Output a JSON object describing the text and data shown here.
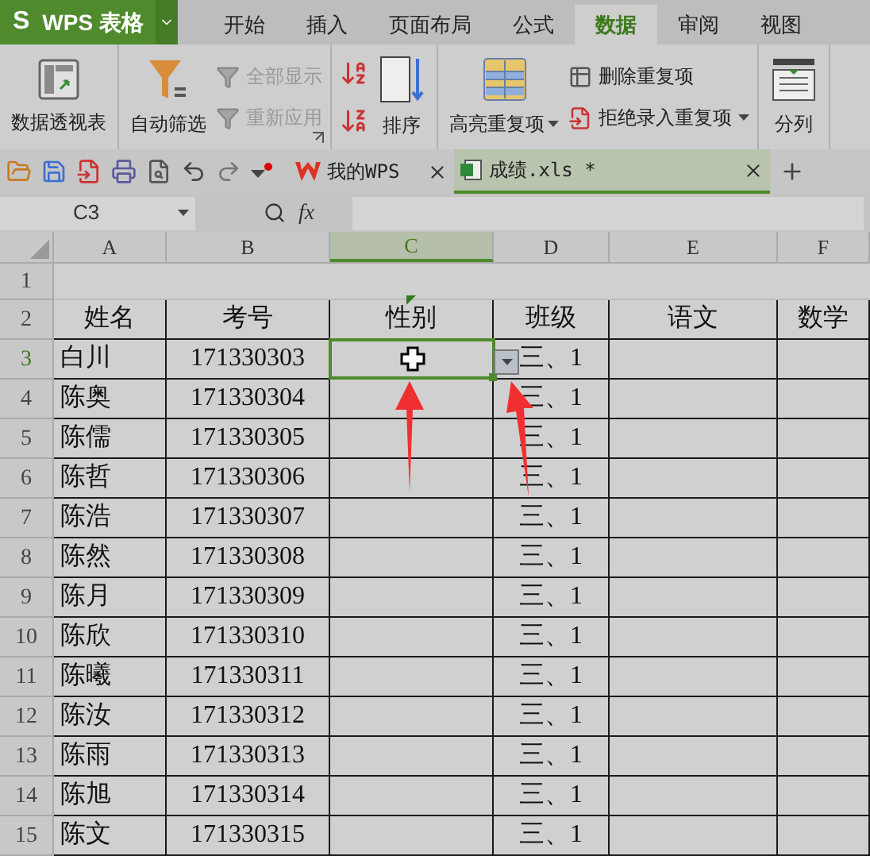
{
  "app": {
    "logo": "S",
    "name": "WPS 表格"
  },
  "menu_tabs": [
    {
      "label": "开始",
      "selected": false
    },
    {
      "label": "插入",
      "selected": false
    },
    {
      "label": "页面布局",
      "selected": false
    },
    {
      "label": "公式",
      "selected": false
    },
    {
      "label": "数据",
      "selected": true
    },
    {
      "label": "审阅",
      "selected": false
    },
    {
      "label": "视图",
      "selected": false
    }
  ],
  "ribbon_groups": [
    {
      "launcher": false,
      "items": [
        {
          "kind": "large",
          "label": "数据透视表",
          "dropdown": false
        }
      ]
    },
    {
      "launcher": true,
      "items": [
        {
          "kind": "large",
          "label": "自动筛选",
          "dropdown": false
        },
        {
          "kind": "stack",
          "items": [
            {
              "label": "全部显示",
              "disabled": true,
              "dropdown": false
            },
            {
              "label": "重新应用",
              "disabled": true,
              "dropdown": false
            }
          ]
        }
      ]
    },
    {
      "launcher": false,
      "items": [
        {
          "kind": "icon_stack"
        },
        {
          "kind": "large",
          "label": "排序",
          "dropdown": false
        }
      ]
    },
    {
      "launcher": false,
      "items": [
        {
          "kind": "large",
          "label": "高亮重复项",
          "dropdown": true
        },
        {
          "kind": "stack",
          "items": [
            {
              "label": "删除重复项",
              "disabled": false,
              "dropdown": false
            },
            {
              "label": "拒绝录入重复项",
              "disabled": false,
              "dropdown": true
            }
          ]
        }
      ]
    },
    {
      "launcher": false,
      "items": [
        {
          "kind": "large",
          "label": "分列",
          "dropdown": false
        }
      ]
    }
  ],
  "doc_tabs": [
    {
      "label": "我的WPS",
      "selected": false
    },
    {
      "label": "成绩.xls *",
      "selected": true
    }
  ],
  "formula_bar": {
    "name_box": "C3",
    "fx": "fx"
  },
  "columns": [
    {
      "label": "A",
      "selected": false
    },
    {
      "label": "B",
      "selected": false
    },
    {
      "label": "C",
      "selected": true
    },
    {
      "label": "D",
      "selected": false
    },
    {
      "label": "E",
      "selected": false
    },
    {
      "label": "F",
      "selected": false
    }
  ],
  "rows": [
    {
      "number": "1",
      "kind": "blank",
      "selected": false
    },
    {
      "number": "2",
      "kind": "header",
      "selected": false,
      "cells": [
        "姓名",
        "考号",
        "性别",
        "班级",
        "语文",
        "数学"
      ]
    },
    {
      "number": "3",
      "kind": "data",
      "selected": true,
      "name": "白川",
      "exam_no": "171330303",
      "class_name": "三、1"
    },
    {
      "number": "4",
      "kind": "data",
      "selected": false,
      "name": "陈奥",
      "exam_no": "171330304",
      "class_name": "三、1"
    },
    {
      "number": "5",
      "kind": "data",
      "selected": false,
      "name": "陈儒",
      "exam_no": "171330305",
      "class_name": "三、1"
    },
    {
      "number": "6",
      "kind": "data",
      "selected": false,
      "name": "陈哲",
      "exam_no": "171330306",
      "class_name": "三、1"
    },
    {
      "number": "7",
      "kind": "data",
      "selected": false,
      "name": "陈浩",
      "exam_no": "171330307",
      "class_name": "三、1"
    },
    {
      "number": "8",
      "kind": "data",
      "selected": false,
      "name": "陈然",
      "exam_no": "171330308",
      "class_name": "三、1"
    },
    {
      "number": "9",
      "kind": "data",
      "selected": false,
      "name": "陈月",
      "exam_no": "171330309",
      "class_name": "三、1"
    },
    {
      "number": "10",
      "kind": "data",
      "selected": false,
      "name": "陈欣",
      "exam_no": "171330310",
      "class_name": "三、1"
    },
    {
      "number": "11",
      "kind": "data",
      "selected": false,
      "name": "陈曦",
      "exam_no": "171330311",
      "class_name": "三、1"
    },
    {
      "number": "12",
      "kind": "data",
      "selected": false,
      "name": "陈汝",
      "exam_no": "171330312",
      "class_name": "三、1"
    },
    {
      "number": "13",
      "kind": "data",
      "selected": false,
      "name": "陈雨",
      "exam_no": "171330313",
      "class_name": "三、1"
    },
    {
      "number": "14",
      "kind": "data",
      "selected": false,
      "name": "陈旭",
      "exam_no": "171330314",
      "class_name": "三、1"
    },
    {
      "number": "15",
      "kind": "data",
      "selected": false,
      "name": "陈文",
      "exam_no": "171330315",
      "class_name": "三、1"
    }
  ]
}
